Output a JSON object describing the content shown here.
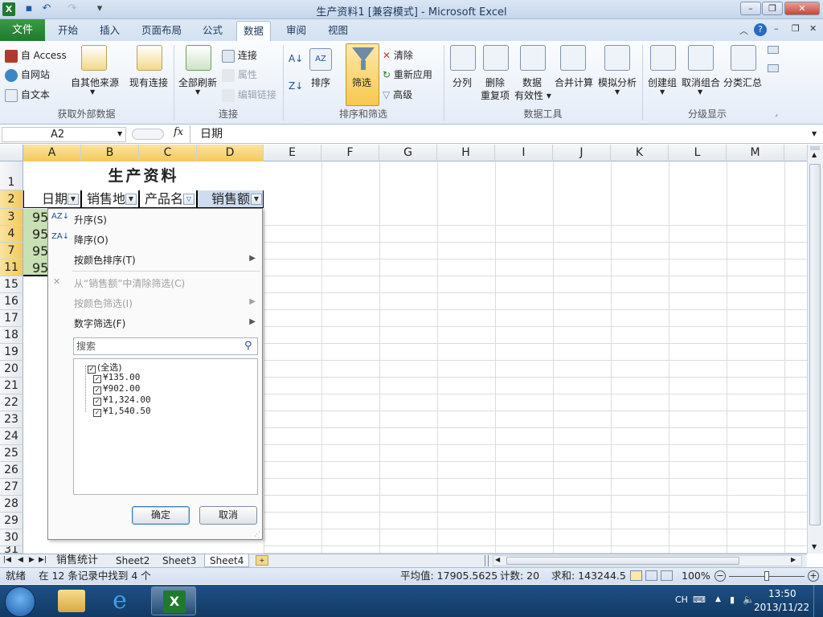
{
  "window": {
    "title": "生产资料1  [兼容模式] - Microsoft Excel"
  },
  "tabs": {
    "file": "文件",
    "items": [
      "开始",
      "插入",
      "页面布局",
      "公式",
      "数据",
      "审阅",
      "视图"
    ],
    "active_index": 4
  },
  "ribbon": {
    "ext": {
      "access": "自 Access",
      "web": "自网站",
      "text": "自文本",
      "other": "自其他来源",
      "existing": "现有连接",
      "label": "获取外部数据"
    },
    "conn": {
      "refresh": "全部刷新",
      "connections": "连接",
      "properties": "属性",
      "edit_links": "编辑链接",
      "label": "连接"
    },
    "sort": {
      "sort": "排序",
      "filter": "筛选",
      "clear": "清除",
      "reapply": "重新应用",
      "advanced": "高级",
      "label": "排序和筛选"
    },
    "tools": {
      "split": "分列",
      "remove_dup_1": "删除",
      "remove_dup_2": "重复项",
      "validation_1": "数据",
      "validation_2": "有效性",
      "consolidate": "合并计算",
      "whatif": "模拟分析",
      "label": "数据工具"
    },
    "outline": {
      "group": "创建组",
      "ungroup": "取消组合",
      "subtotal": "分类汇总",
      "label": "分级显示"
    }
  },
  "formula_bar": {
    "name_box": "A2",
    "fx": "fx",
    "content": "日期"
  },
  "columns": [
    "A",
    "B",
    "C",
    "D",
    "E",
    "F",
    "G",
    "H",
    "I",
    "J",
    "K",
    "L",
    "M"
  ],
  "rows": [
    "1",
    "2",
    "3",
    "4",
    "7",
    "11",
    "15",
    "16",
    "17",
    "18",
    "19",
    "20",
    "21",
    "22",
    "23",
    "24",
    "25",
    "26",
    "27",
    "28",
    "29",
    "30",
    "31"
  ],
  "sheet": {
    "title": "生产资料",
    "headers": [
      "日期",
      "销售地",
      "产品名",
      "销售额"
    ],
    "a_values": [
      "95",
      "95",
      "95.",
      "95"
    ]
  },
  "filter_menu": {
    "sort_asc": "升序(S)",
    "sort_desc": "降序(O)",
    "sort_color": "按颜色排序(T)",
    "clear": "从“销售额”中清除筛选(C)",
    "filter_color": "按颜色筛选(I)",
    "number_filter": "数字筛选(F)",
    "search_placeholder": "搜索",
    "items": [
      "(全选)",
      "¥135.00",
      "¥902.00",
      "¥1,324.00",
      "¥1,540.50"
    ],
    "ok": "确定",
    "cancel": "取消"
  },
  "sheet_tabs": [
    "销售统计",
    "Sheet2",
    "Sheet3",
    "Sheet4"
  ],
  "status": {
    "ready": "就绪",
    "found": "在 12 条记录中找到 4 个",
    "average": "平均值: 17905.5625",
    "count": "计数: 20",
    "sum": "求和: 143244.5",
    "zoom": "100%"
  },
  "taskbar": {
    "lang": "CH",
    "time": "13:50",
    "date": "2013/11/22"
  }
}
